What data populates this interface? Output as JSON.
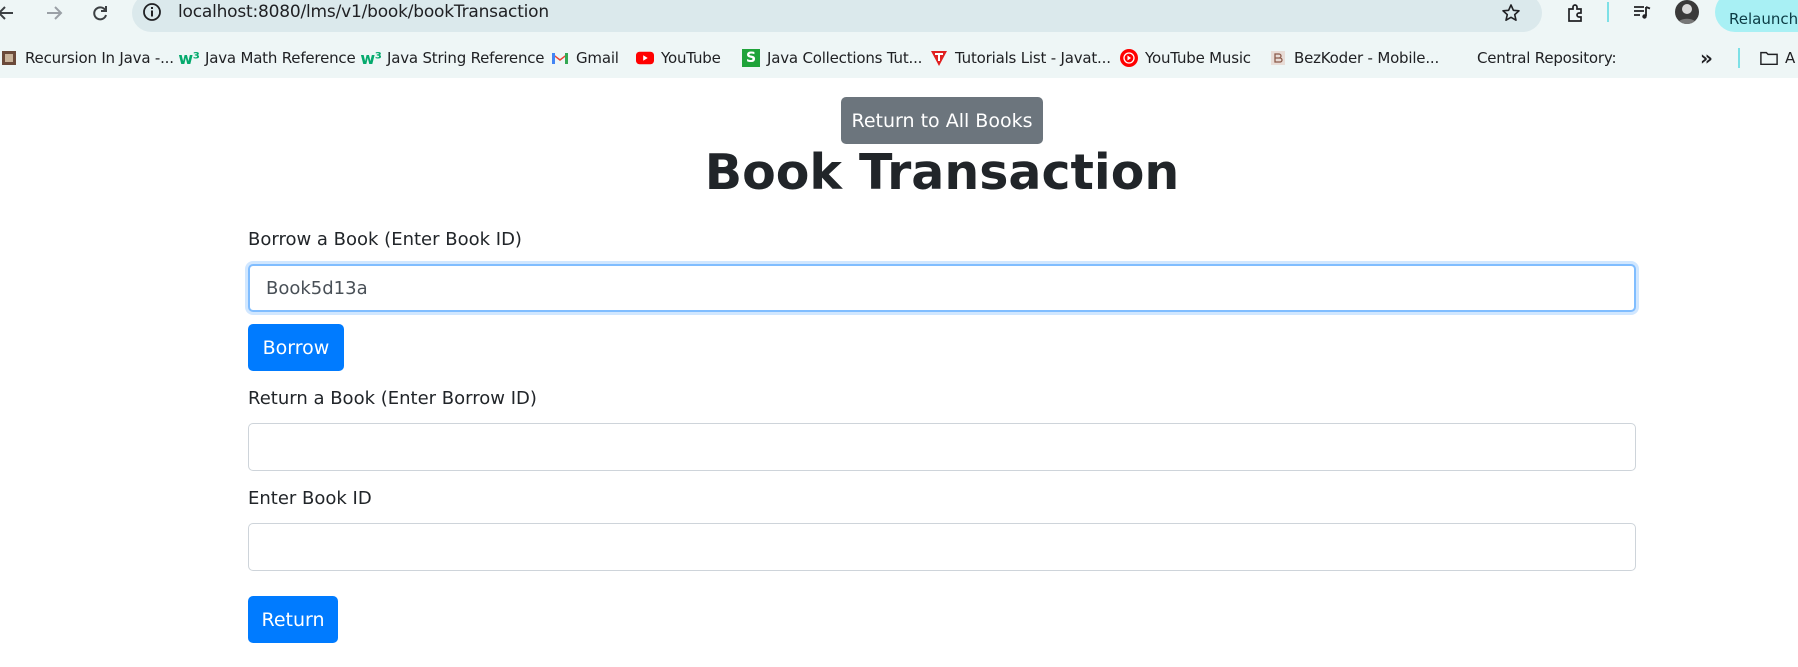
{
  "browser": {
    "url": "localhost:8080/lms/v1/book/bookTransaction",
    "relaunch_label": "Relaunch t",
    "bookmarks": [
      {
        "label": "Recursion In Java -...",
        "icon": "image-favicon"
      },
      {
        "label": "Java Math Reference",
        "icon": "w3schools-icon"
      },
      {
        "label": "Java String Reference",
        "icon": "w3schools-icon"
      },
      {
        "label": "Gmail",
        "icon": "gmail-icon"
      },
      {
        "label": "YouTube",
        "icon": "youtube-icon"
      },
      {
        "label": "Java Collections Tut...",
        "icon": "s-green-icon"
      },
      {
        "label": "Tutorials List - Javat...",
        "icon": "t-red-icon"
      },
      {
        "label": "YouTube Music",
        "icon": "youtube-music-icon"
      },
      {
        "label": "BezKoder - Mobile...",
        "icon": "bezkoder-icon"
      },
      {
        "label": "Central Repository:",
        "icon": ""
      },
      {
        "label": "A",
        "icon": "folder-icon"
      }
    ]
  },
  "page": {
    "return_all_label": "Return to All Books",
    "title": "Book Transaction",
    "borrow_label": "Borrow a Book (Enter Book ID)",
    "borrow_input_value": "Book5d13a",
    "borrow_button": "Borrow",
    "return_label": "Return a Book (Enter Borrow ID)",
    "return_input_value": "",
    "book_id_label": "Enter Book ID",
    "book_id_input_value": "",
    "return_button": "Return"
  },
  "colors": {
    "primary": "#007bff",
    "secondary": "#6c757d",
    "focus_border": "#80bdff"
  }
}
